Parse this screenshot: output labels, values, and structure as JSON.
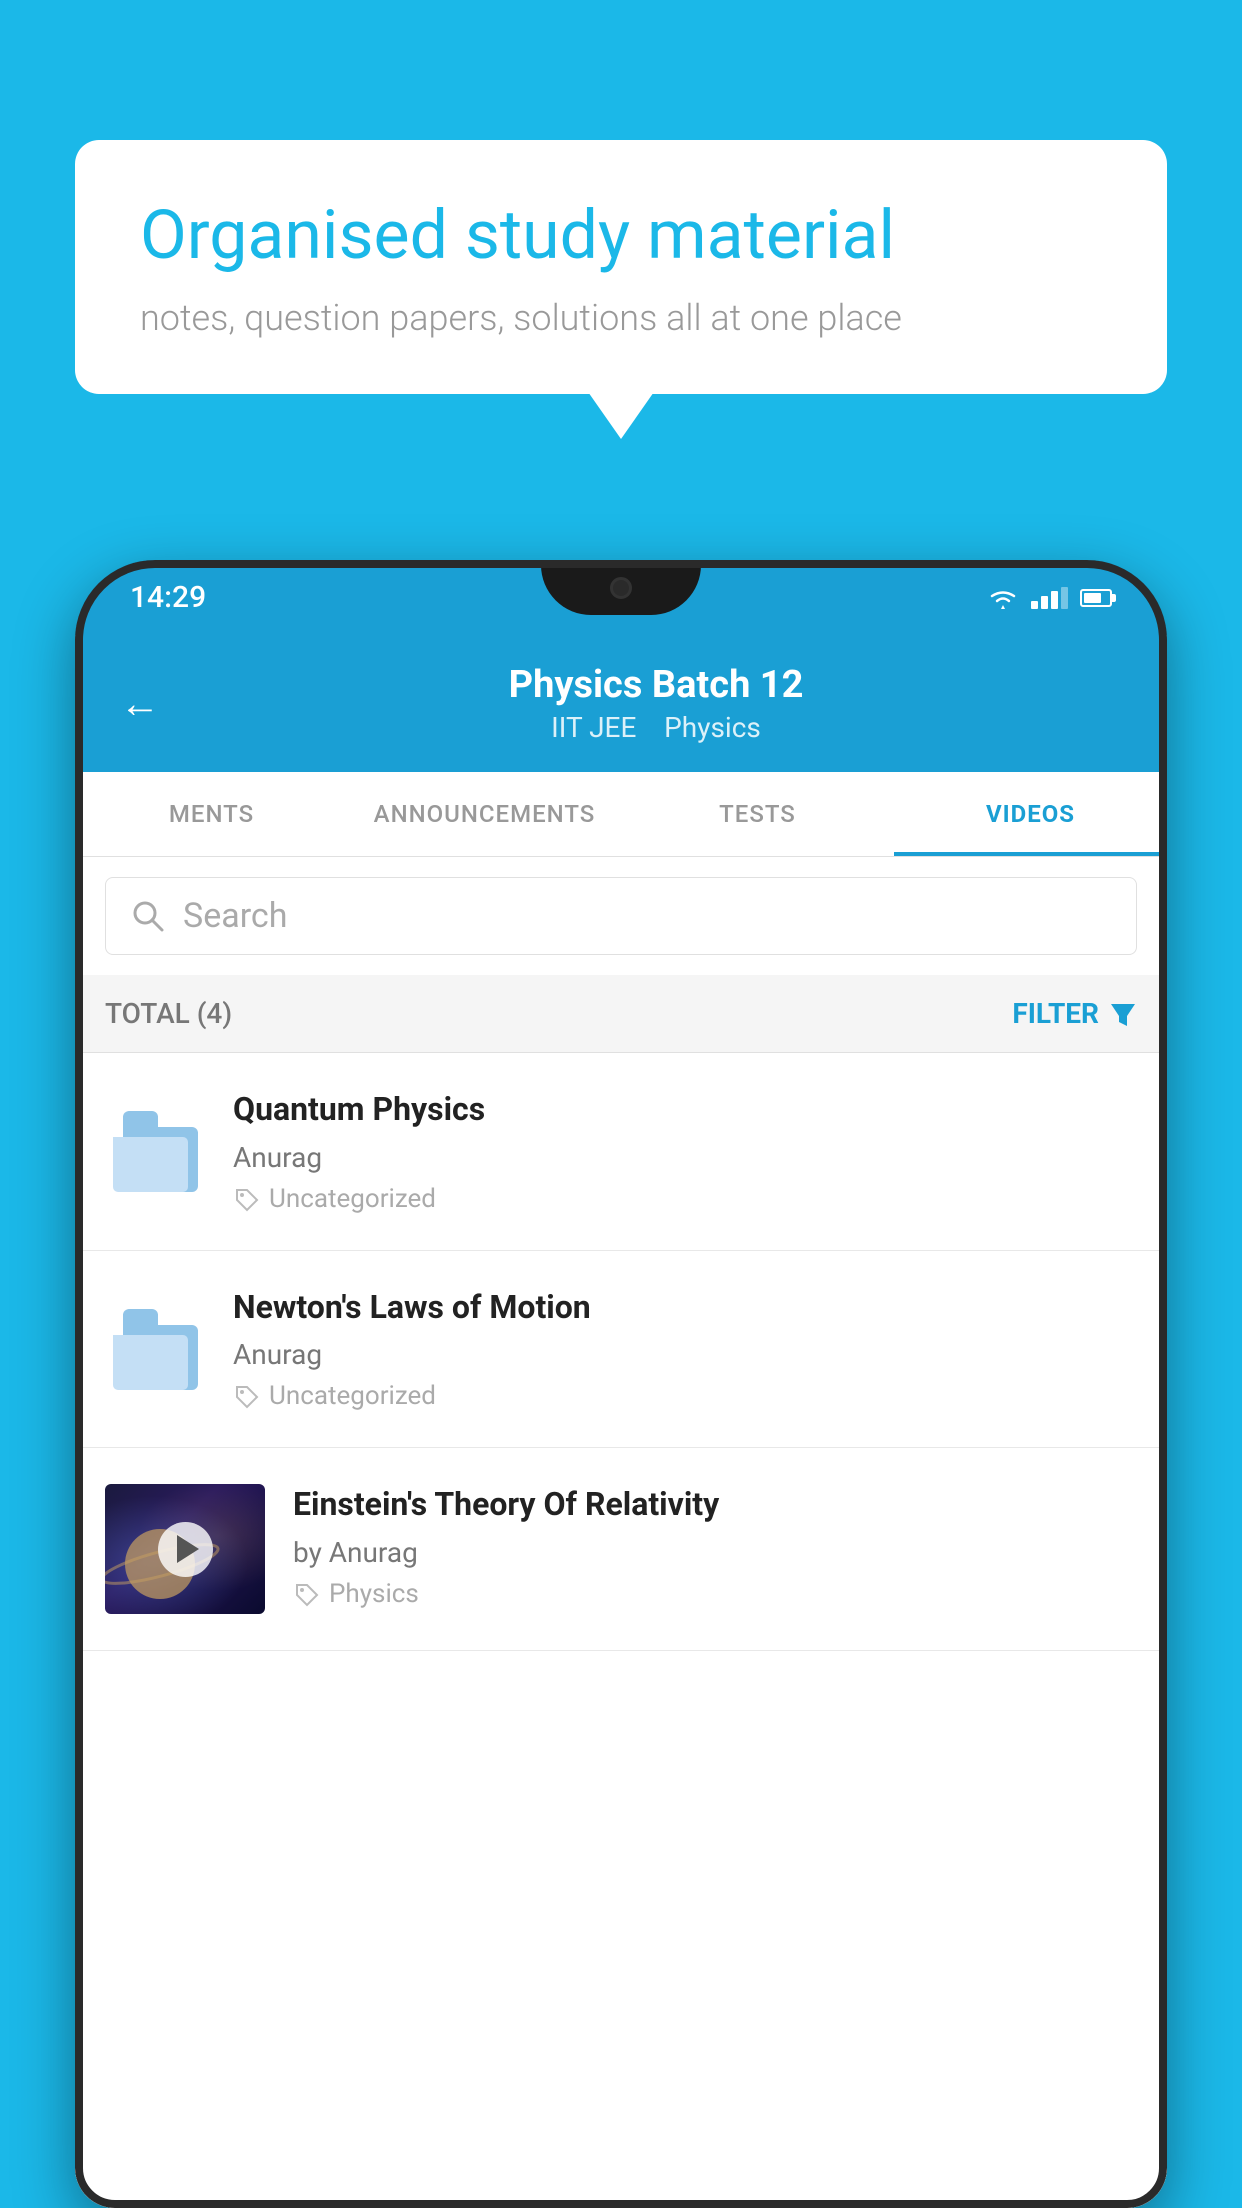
{
  "background_color": "#1BB8E8",
  "speech_bubble": {
    "headline": "Organised study material",
    "subtext": "notes, question papers, solutions all at one place"
  },
  "phone": {
    "status_bar": {
      "time": "14:29",
      "wifi": true,
      "signal": true,
      "battery": true
    },
    "header": {
      "title": "Physics Batch 12",
      "subtitle_part1": "IIT JEE",
      "subtitle_part2": "Physics",
      "back_label": "←"
    },
    "tabs": [
      {
        "label": "MENTS",
        "active": false
      },
      {
        "label": "ANNOUNCEMENTS",
        "active": false
      },
      {
        "label": "TESTS",
        "active": false
      },
      {
        "label": "VIDEOS",
        "active": true
      }
    ],
    "search": {
      "placeholder": "Search"
    },
    "filter_bar": {
      "total_label": "TOTAL (4)",
      "filter_label": "FILTER"
    },
    "videos": [
      {
        "title": "Quantum Physics",
        "author": "Anurag",
        "tag": "Uncategorized",
        "has_thumbnail": false
      },
      {
        "title": "Newton's Laws of Motion",
        "author": "Anurag",
        "tag": "Uncategorized",
        "has_thumbnail": false
      },
      {
        "title": "Einstein's Theory Of Relativity",
        "author": "by Anurag",
        "tag": "Physics",
        "has_thumbnail": true
      }
    ]
  }
}
